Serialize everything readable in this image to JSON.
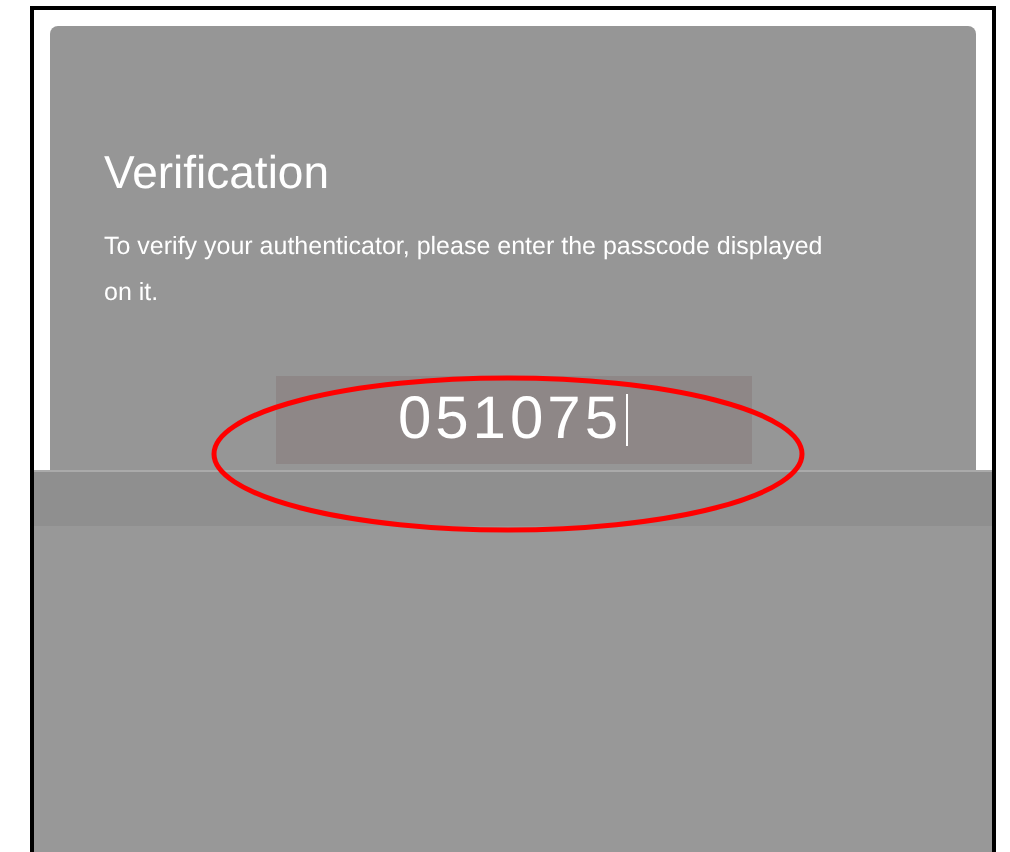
{
  "dialog": {
    "title": "Verification",
    "message": "To verify your authenticator, please enter the passcode displayed on it."
  },
  "passcode_field": {
    "value": "051075"
  }
}
